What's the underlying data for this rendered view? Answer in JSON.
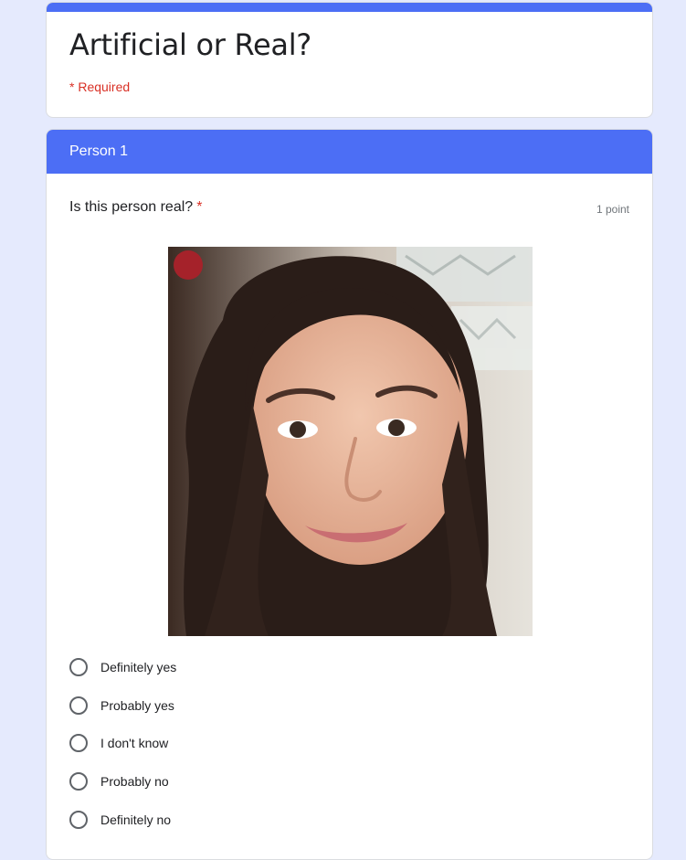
{
  "form": {
    "title": "Artificial or Real?",
    "required_note": "* Required"
  },
  "section": {
    "header": "Person 1",
    "question": {
      "text": "Is this person real?",
      "required_mark": "*",
      "points": "1 point",
      "options": [
        {
          "label": "Definitely yes"
        },
        {
          "label": "Probably yes"
        },
        {
          "label": "I don't know"
        },
        {
          "label": "Probably no"
        },
        {
          "label": "Definitely no"
        }
      ]
    }
  },
  "colors": {
    "accent": "#4c6ef5",
    "background": "#e5eafd",
    "required": "#d93025"
  }
}
